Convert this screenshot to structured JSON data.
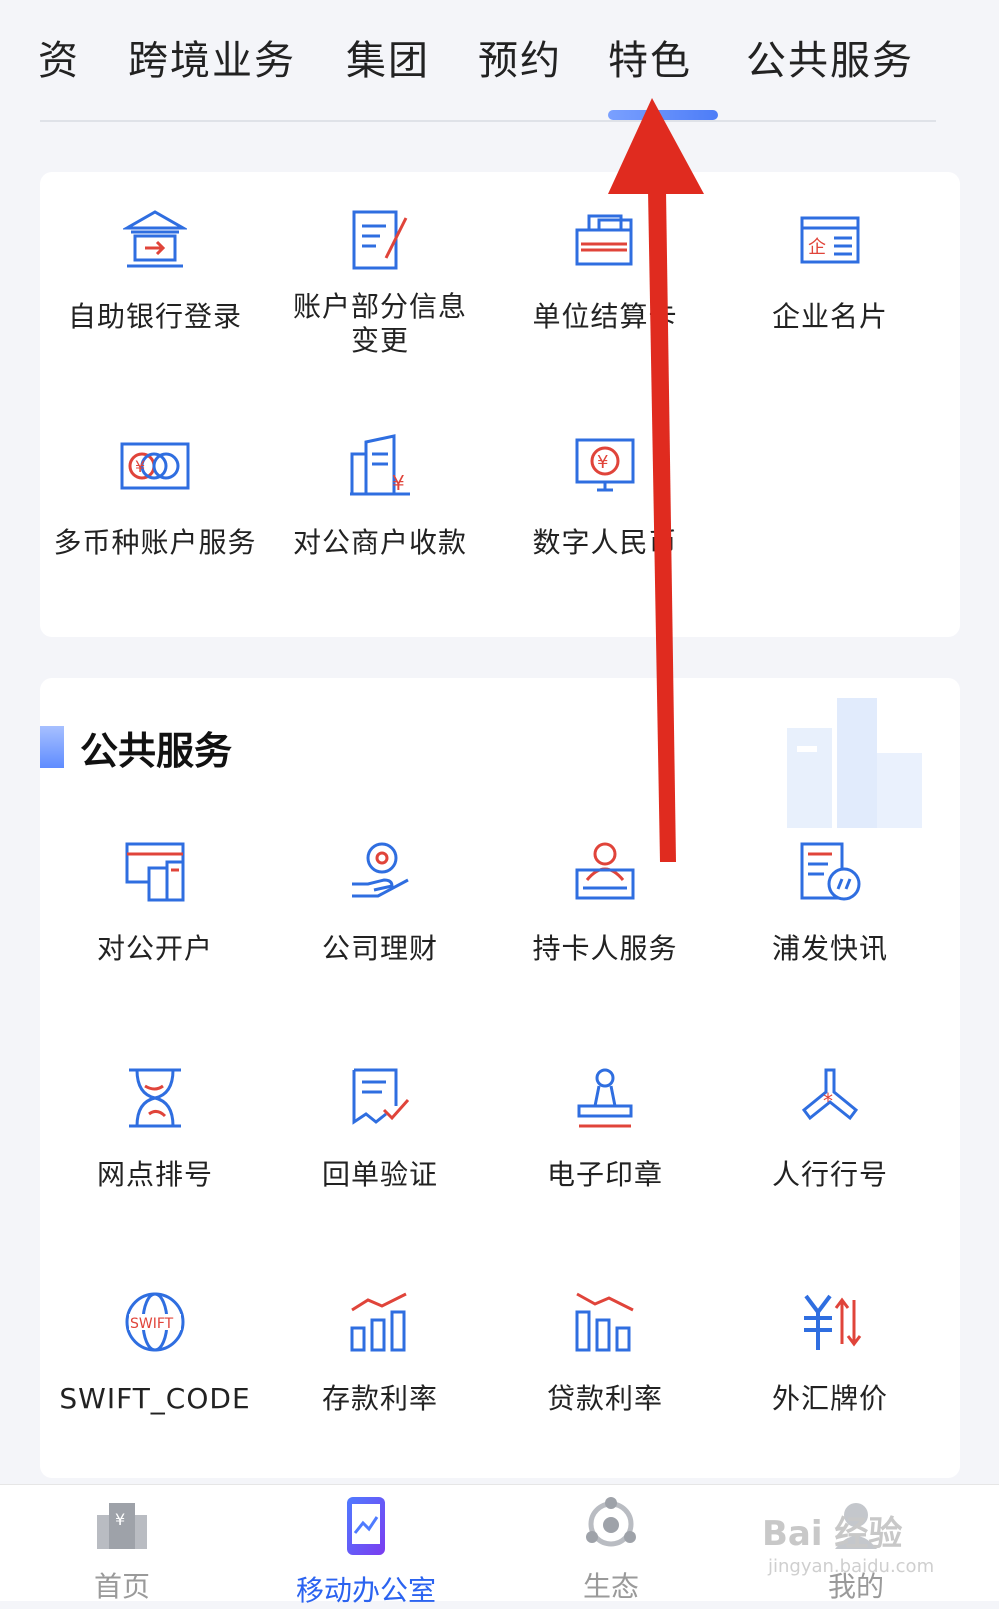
{
  "tabs": [
    "资",
    "跨境业务",
    "集团",
    "预约",
    "特色",
    "公共服务"
  ],
  "active_tab_index": 4,
  "features_card": {
    "items": [
      {
        "label": "自助银行登录",
        "icon": "bank-login-icon"
      },
      {
        "label": "账户部分信息\n变更",
        "icon": "account-edit-icon"
      },
      {
        "label": "单位结算卡",
        "icon": "settlement-card-icon"
      },
      {
        "label": "企业名片",
        "icon": "business-card-icon"
      },
      {
        "label": "多币种账户服务",
        "icon": "multi-currency-icon"
      },
      {
        "label": "对公商户收款",
        "icon": "merchant-collection-icon"
      },
      {
        "label": "数字人民币",
        "icon": "digital-rmb-icon"
      }
    ]
  },
  "public_service": {
    "title": "公共服务",
    "items": [
      {
        "label": "对公开户",
        "icon": "open-account-icon"
      },
      {
        "label": "公司理财",
        "icon": "wealth-icon"
      },
      {
        "label": "持卡人服务",
        "icon": "cardholder-icon"
      },
      {
        "label": "浦发快讯",
        "icon": "news-icon"
      },
      {
        "label": "网点排号",
        "icon": "queue-icon"
      },
      {
        "label": "回单验证",
        "icon": "receipt-verify-icon"
      },
      {
        "label": "电子印章",
        "icon": "e-seal-icon"
      },
      {
        "label": "人行行号",
        "icon": "bank-code-icon"
      },
      {
        "label": "SWIFT_CODE",
        "icon": "swift-icon"
      },
      {
        "label": "存款利率",
        "icon": "deposit-rate-icon"
      },
      {
        "label": "贷款利率",
        "icon": "loan-rate-icon"
      },
      {
        "label": "外汇牌价",
        "icon": "fx-rate-icon"
      }
    ]
  },
  "bottom_nav": [
    {
      "label": "首页",
      "icon": "home-icon"
    },
    {
      "label": "移动办公室",
      "icon": "mobile-office-icon"
    },
    {
      "label": "生态",
      "icon": "ecosystem-icon"
    },
    {
      "label": "我的",
      "icon": "profile-icon"
    }
  ],
  "active_nav_index": 1,
  "watermark": {
    "text": "Bai 经验",
    "sub": "jingyan.baidu.com"
  },
  "colors": {
    "blue": "#2f6ee0",
    "red": "#e0443a",
    "active": "#2b63f0",
    "arrow": "#e02b1f"
  }
}
